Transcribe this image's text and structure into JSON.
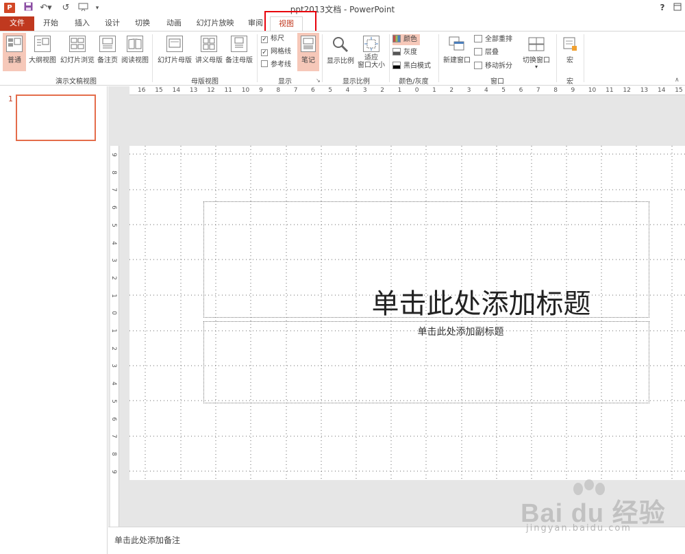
{
  "window": {
    "title": "ppt2013文档 - PowerPoint",
    "help": "?",
    "app_logo": "P"
  },
  "tabs": [
    {
      "label": "文件"
    },
    {
      "label": "开始"
    },
    {
      "label": "插入"
    },
    {
      "label": "设计"
    },
    {
      "label": "切换"
    },
    {
      "label": "动画"
    },
    {
      "label": "幻灯片放映"
    },
    {
      "label": "审阅"
    },
    {
      "label": "视图"
    }
  ],
  "active_tab": "视图",
  "ribbon": {
    "presentation_views": {
      "label": "演示文稿视图",
      "buttons": [
        "普通",
        "大纲视图",
        "幻灯片浏览",
        "备注页",
        "阅读视图"
      ]
    },
    "master_views": {
      "label": "母版视图",
      "buttons": [
        "幻灯片母版",
        "讲义母版",
        "备注母版"
      ]
    },
    "show": {
      "label": "显示",
      "checks": [
        {
          "label": "标尺",
          "checked": true
        },
        {
          "label": "网格线",
          "checked": true
        },
        {
          "label": "参考线",
          "checked": false
        }
      ],
      "notes_button": "笔记"
    },
    "zoom": {
      "label": "显示比例",
      "zoom_button": "显示比例",
      "fit_button_line1": "适应",
      "fit_button_line2": "窗口大小"
    },
    "color": {
      "label": "颜色/灰度",
      "options": [
        "颜色",
        "灰度",
        "黑白模式"
      ],
      "selected": "颜色"
    },
    "window": {
      "label": "窗口",
      "new_window": "新建窗口",
      "arrange_all": "全部重排",
      "cascade": "层叠",
      "move_split": "移动拆分",
      "switch_window": "切换窗口"
    },
    "macros": {
      "label": "宏",
      "button": "宏"
    }
  },
  "thumbnails": {
    "slide_number": "1"
  },
  "ruler": {
    "h_labels": [
      "16",
      "15",
      "14",
      "13",
      "12",
      "11",
      "10",
      "9",
      "8",
      "7",
      "6",
      "5",
      "4",
      "3",
      "2",
      "1",
      "0",
      "1",
      "2",
      "3",
      "4",
      "5",
      "6",
      "7",
      "8",
      "9",
      "10",
      "11",
      "12",
      "13",
      "14",
      "15"
    ],
    "v_labels": [
      "9",
      "8",
      "7",
      "6",
      "5",
      "4",
      "3",
      "2",
      "1",
      "0",
      "1",
      "2",
      "3",
      "4",
      "5",
      "6",
      "7",
      "8",
      "9"
    ]
  },
  "slide": {
    "title_placeholder": "单击此处添加标题",
    "subtitle_placeholder": "单击此处添加副标题"
  },
  "notes": {
    "placeholder": "单击此处添加备注"
  },
  "watermark": {
    "brand": "Bai du 经验",
    "site": "jingyan.baidu.com"
  }
}
